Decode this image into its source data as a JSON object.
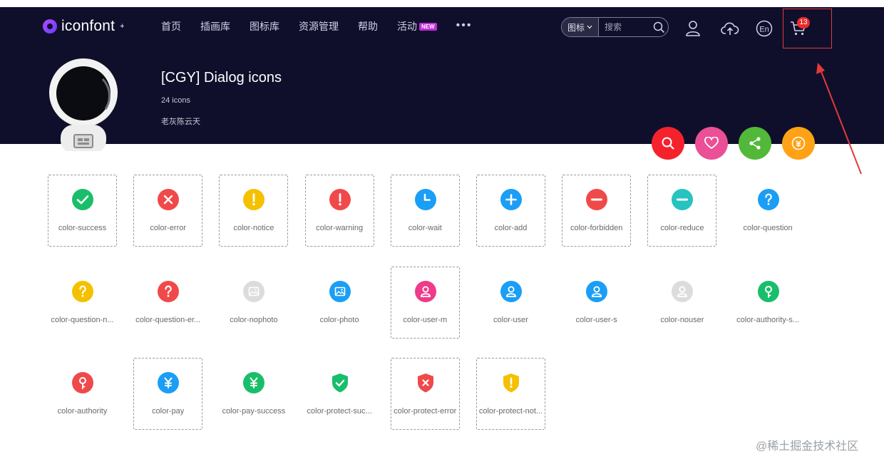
{
  "header": {
    "logo": {
      "text": "iconfont",
      "superscript": "+"
    },
    "nav": [
      {
        "label": "首页"
      },
      {
        "label": "插画库"
      },
      {
        "label": "图标库"
      },
      {
        "label": "资源管理"
      },
      {
        "label": "帮助"
      },
      {
        "label": "活动",
        "badge": "NEW"
      }
    ],
    "more": "•••",
    "search": {
      "type": "图标",
      "placeholder": "搜索"
    },
    "cart_count": "13",
    "language": "En"
  },
  "collection": {
    "title": "[CGY] Dialog icons",
    "count": "24 icons",
    "author": "老灰陈云天"
  },
  "actions": [
    {
      "name": "search",
      "color": "#f5222d"
    },
    {
      "name": "favorite",
      "color": "#eb4f96"
    },
    {
      "name": "share",
      "color": "#52b83a"
    },
    {
      "name": "reward",
      "color": "#ffa216"
    }
  ],
  "icons": [
    {
      "label": "color-success",
      "color": "#19be6b",
      "glyph": "check",
      "outlined": true
    },
    {
      "label": "color-error",
      "color": "#f0494a",
      "glyph": "cross",
      "outlined": true
    },
    {
      "label": "color-notice",
      "color": "#f5c000",
      "glyph": "exclaim",
      "outlined": true
    },
    {
      "label": "color-warning",
      "color": "#f0494a",
      "glyph": "exclaim",
      "outlined": true
    },
    {
      "label": "color-wait",
      "color": "#1b9ef5",
      "glyph": "clock",
      "outlined": true
    },
    {
      "label": "color-add",
      "color": "#1b9ef5",
      "glyph": "plus",
      "outlined": true
    },
    {
      "label": "color-forbidden",
      "color": "#f0494a",
      "glyph": "minus",
      "outlined": true
    },
    {
      "label": "color-reduce",
      "color": "#26c3c0",
      "glyph": "minus",
      "outlined": true
    },
    {
      "label": "color-question",
      "color": "#1b9ef5",
      "glyph": "question",
      "outlined": false
    },
    {
      "label": "color-question-n...",
      "color": "#f5c000",
      "glyph": "question",
      "outlined": false
    },
    {
      "label": "color-question-er...",
      "color": "#f0494a",
      "glyph": "question",
      "outlined": false
    },
    {
      "label": "color-nophoto",
      "color": "#dcdcdc",
      "glyph": "photo",
      "outlined": false
    },
    {
      "label": "color-photo",
      "color": "#1b9ef5",
      "glyph": "photo",
      "outlined": false
    },
    {
      "label": "color-user-m",
      "color": "#ee3b8a",
      "glyph": "user",
      "outlined": true
    },
    {
      "label": "color-user",
      "color": "#1b9ef5",
      "glyph": "user",
      "outlined": false
    },
    {
      "label": "color-user-s",
      "color": "#1b9ef5",
      "glyph": "user",
      "outlined": false
    },
    {
      "label": "color-nouser",
      "color": "#dcdcdc",
      "glyph": "user",
      "outlined": false
    },
    {
      "label": "color-authority-s...",
      "color": "#19be6b",
      "glyph": "key",
      "outlined": false
    },
    {
      "label": "color-authority",
      "color": "#f0494a",
      "glyph": "key",
      "outlined": false
    },
    {
      "label": "color-pay",
      "color": "#1b9ef5",
      "glyph": "yen",
      "outlined": true
    },
    {
      "label": "color-pay-success",
      "color": "#19be6b",
      "glyph": "yen",
      "outlined": false
    },
    {
      "label": "color-protect-suc...",
      "color": "#19be6b",
      "glyph": "shield-check",
      "outlined": false
    },
    {
      "label": "color-protect-error",
      "color": "#f0494a",
      "glyph": "shield-cross",
      "outlined": true
    },
    {
      "label": "color-protect-not...",
      "color": "#f5c000",
      "glyph": "shield-exclaim",
      "outlined": true
    }
  ],
  "watermark": "@稀土掘金技术社区"
}
